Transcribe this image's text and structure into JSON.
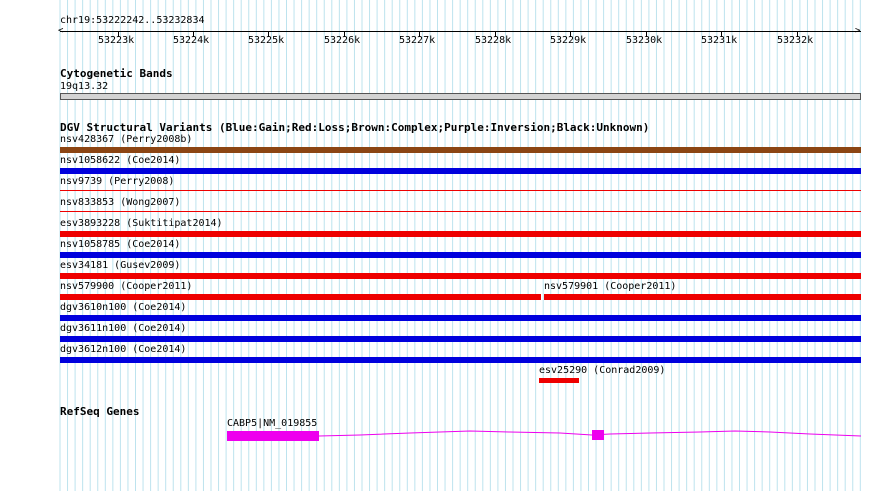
{
  "ruler": {
    "position": "chr19:53222242..53232834",
    "ticks": [
      "53223k",
      "53224k",
      "53225k",
      "53226k",
      "53227k",
      "53228k",
      "53229k",
      "53230k",
      "53231k",
      "53232k"
    ]
  },
  "tracks": {
    "cytoband": {
      "title": "Cytogenetic Bands",
      "band": "19q13.32"
    },
    "dgv": {
      "title": "DGV Structural Variants (Blue:Gain;Red:Loss;Brown:Complex;Purple:Inversion;Black:Unknown)",
      "colors": {
        "gain": "#0000dd",
        "loss": "#ee0000",
        "complex": "#8b4513"
      },
      "features": [
        {
          "label": "nsv428367 (Perry2008b)",
          "type": "complex"
        },
        {
          "label": "nsv1058622 (Coe2014)",
          "type": "gain"
        },
        {
          "label": "nsv9739 (Perry2008)",
          "type": "loss"
        },
        {
          "label": "nsv833853 (Wong2007)",
          "type": "loss"
        },
        {
          "label": "esv3893228 (Suktitipat2014)",
          "type": "loss"
        },
        {
          "label": "nsv1058785 (Coe2014)",
          "type": "gain"
        },
        {
          "label": "esv34181 (Gusev2009)",
          "type": "loss"
        },
        {
          "label": "nsv579900 (Cooper2011)",
          "type": "loss"
        },
        {
          "label": "nsv579901 (Cooper2011)",
          "type": "loss"
        },
        {
          "label": "dgv3610n100 (Coe2014)",
          "type": "gain"
        },
        {
          "label": "dgv3611n100 (Coe2014)",
          "type": "gain"
        },
        {
          "label": "dgv3612n100 (Coe2014)",
          "type": "gain"
        },
        {
          "label": "esv25290 (Conrad2009)",
          "type": "loss"
        }
      ]
    },
    "refseq": {
      "title": "RefSeq Genes",
      "gene_label": "CABP5|NM_019855",
      "color": "#ee00ee"
    }
  }
}
